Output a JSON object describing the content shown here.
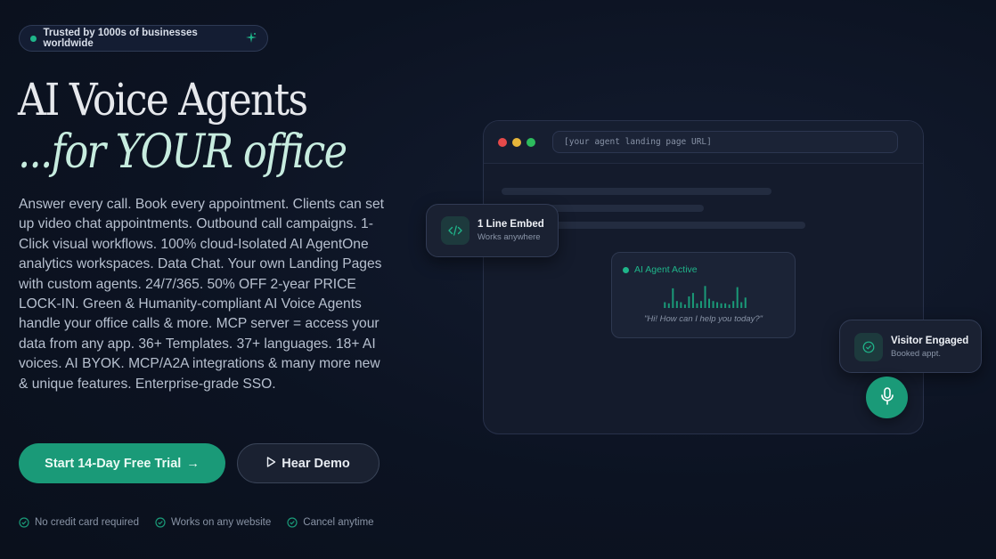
{
  "badge": {
    "text": "Trusted by 1000s of businesses worldwide"
  },
  "hero": {
    "title_line1": "AI Voice Agents",
    "title_line2": "...for YOUR office",
    "description": "Answer every call. Book every appointment. Clients can set up video chat appointments. Outbound call campaigns. 1-Click visual workflows. 100% cloud-Isolated AI AgentOne analytics workspaces. Data Chat. Your own Landing Pages with custom agents. 24/7/365. 50% OFF 2-year PRICE LOCK-IN. Green & Humanity-compliant AI Voice Agents handle your office calls & more. MCP server = access your data from any app. 36+ Templates. 37+ languages. 18+ AI voices. AI BYOK. MCP/A2A integrations & many more new & unique features. Enterprise-grade SSO."
  },
  "cta": {
    "primary_label": "Start 14-Day Free Trial",
    "primary_arrow": "→",
    "secondary_label": "Hear Demo"
  },
  "checks": [
    "No credit card required",
    "Works on any website",
    "Cancel anytime"
  ],
  "preview": {
    "url_placeholder": "[your agent landing page URL]",
    "agent_status": "AI Agent Active",
    "agent_quote": "\"Hi! How can I help you today?\"",
    "waveform_levels": [
      0.25,
      0.2,
      0.85,
      0.3,
      0.25,
      0.15,
      0.5,
      0.65,
      0.2,
      0.3,
      0.95,
      0.4,
      0.3,
      0.25,
      0.2,
      0.2,
      0.15,
      0.3,
      0.9,
      0.25,
      0.45
    ]
  },
  "embed_card": {
    "title": "1 Line Embed",
    "subtitle": "Works anywhere"
  },
  "visitor_card": {
    "title": "Visitor Engaged",
    "subtitle": "Booked appt."
  },
  "colors": {
    "accent": "#1a9a78",
    "accent_light": "#1fb58a",
    "background": "#0c1322",
    "traffic_red": "#e64a4a",
    "traffic_yellow": "#e6b53a",
    "traffic_green": "#2dbb5d"
  },
  "icons": {
    "badge_dot": "status-dot-icon",
    "badge_sparkle": "sparkle-icon",
    "demo": "play-icon",
    "check": "check-circle-icon",
    "embed": "code-icon",
    "visitor": "check-circle-icon",
    "mic": "microphone-icon"
  }
}
